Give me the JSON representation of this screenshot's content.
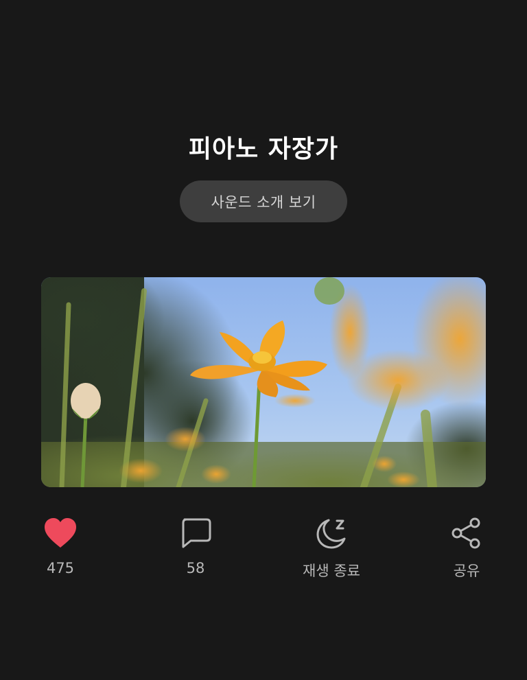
{
  "title": "피아노 자장가",
  "intro_button": "사운드 소개 보기",
  "colors": {
    "background": "#181818",
    "heart": "#ee4a5c",
    "icon": "#b8b8b8",
    "button_bg": "#3e3e3e"
  },
  "artwork": {
    "icon": "cosmos-flower-photo"
  },
  "actions": [
    {
      "icon": "heart-icon",
      "label": "475"
    },
    {
      "icon": "comment-icon",
      "label": "58"
    },
    {
      "icon": "moon-sleep-icon",
      "label": "재생 종료"
    },
    {
      "icon": "share-icon",
      "label": "공유"
    }
  ]
}
